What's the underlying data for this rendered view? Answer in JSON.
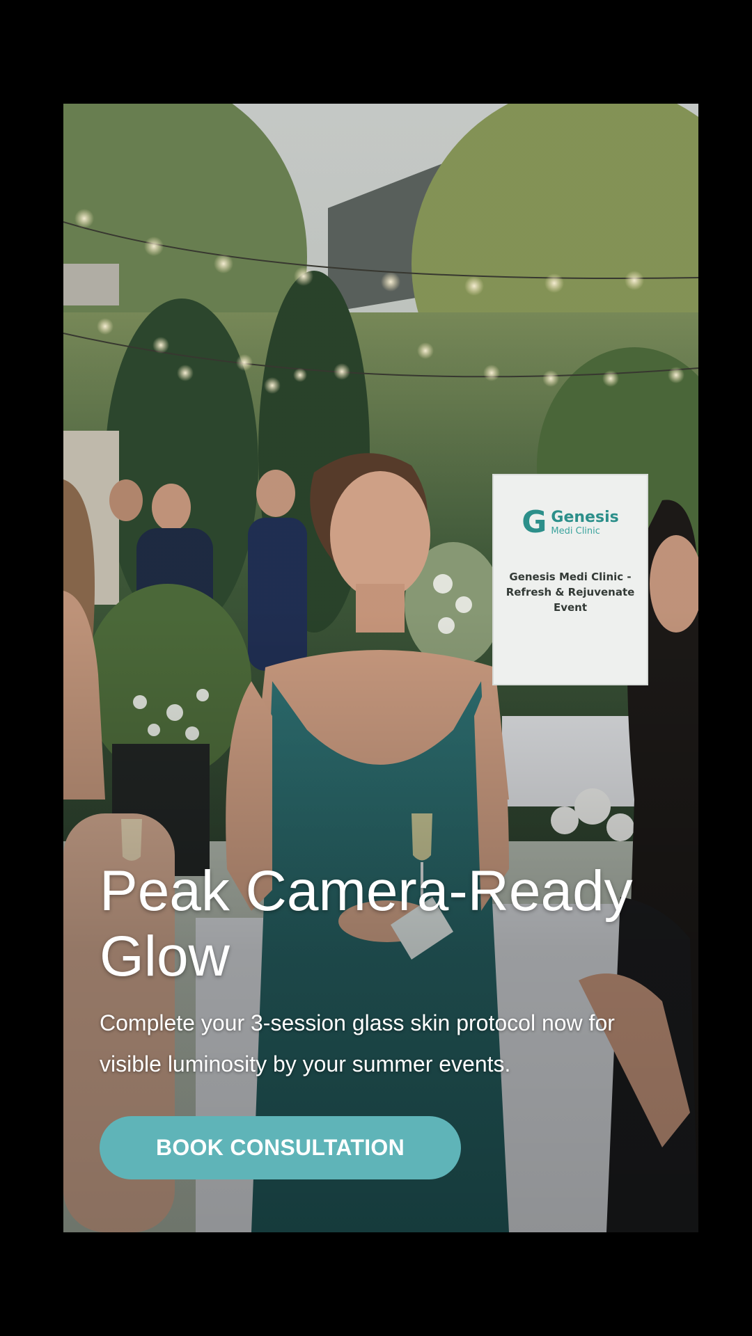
{
  "ad": {
    "headline": "Peak Camera-Ready Glow",
    "subtext": "Complete your 3-session glass skin protocol now for visible luminosity by your summer events.",
    "cta_label": "BOOK CONSULTATION"
  },
  "sign": {
    "brand": "Genesis",
    "brand_sub": "Medi Clinic",
    "caption": "Genesis Medi Clinic -\nRefresh & Rejuvenate\nEvent"
  },
  "colors": {
    "background": "#000000",
    "cta": "#5fb4b8",
    "brand_teal": "#2c8f8a",
    "dress": "#2b6a6c"
  }
}
